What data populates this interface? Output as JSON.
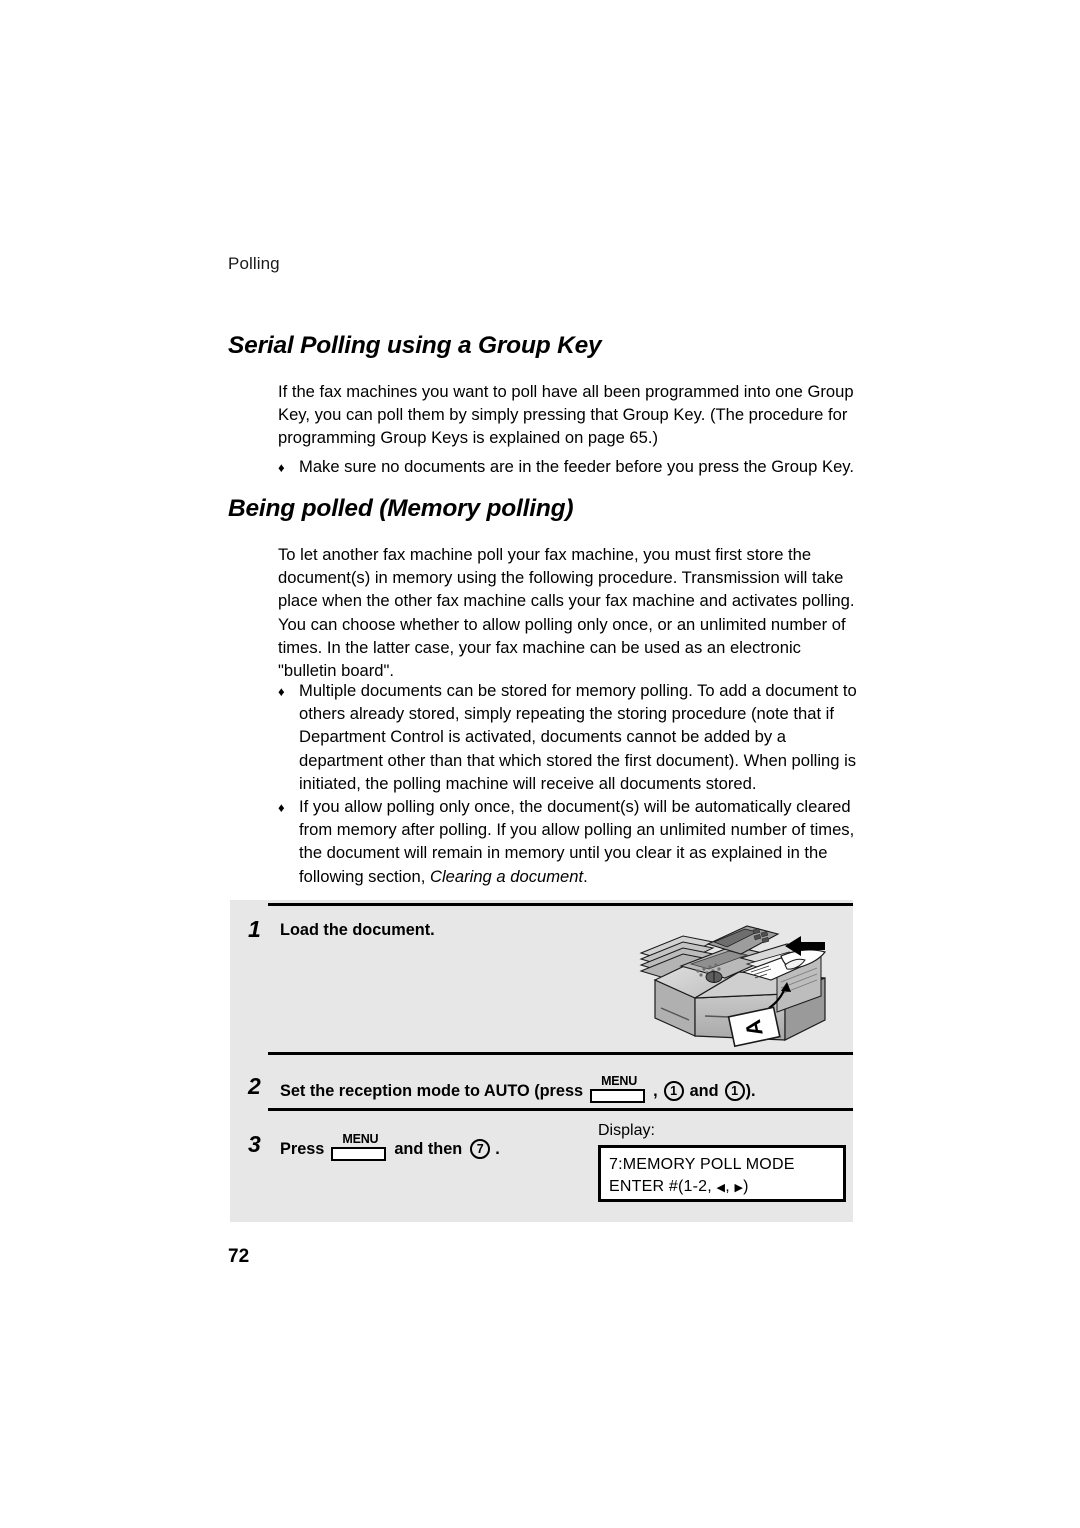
{
  "page": {
    "running_head": "Polling",
    "page_number": "72"
  },
  "sections": [
    {
      "heading": "Serial Polling using a Group Key",
      "paragraph": "If the fax machines you want to poll have all been programmed into one Group Key, you can poll them by simply pressing that Group Key. (The procedure for programming Group Keys is explained on page 65.)",
      "bullet": "Make sure no documents are in the feeder before you press the Group Key."
    },
    {
      "heading": "Being polled (Memory polling)",
      "paragraph": "To let another fax machine poll your fax machine, you must first store the document(s) in memory using the following procedure. Transmission will take place when the other fax machine calls your fax machine and activates polling. You can choose whether to allow polling only once, or an unlimited number of times. In the latter case, your fax machine can be used as an electronic \"bulletin board\".",
      "bullets": [
        "Multiple documents can be stored for memory polling. To add a document to others already stored, simply repeating the storing procedure (note that if Department Control is activated, documents cannot be added by a department other than that which stored the first document). When polling is initiated, the polling machine will receive all documents stored.",
        {
          "lead": "If you allow polling only once, the document(s) will be automatically cleared from memory after polling. If you allow polling an unlimited number of times, the document will remain in memory until you clear it as explained in the following section, ",
          "italic": "Clearing a document",
          "tail": "."
        }
      ]
    }
  ],
  "bullet_marker": "♦",
  "procedure": {
    "steps": [
      {
        "number": "1",
        "text": "Load the document.",
        "illustration": "fax-machine-loading-document"
      },
      {
        "number": "2",
        "text_before": "Set the reception mode to AUTO (press",
        "key1": "MENU",
        "sep": ",",
        "key2": "1",
        "text_mid": "and",
        "key3": "1",
        "text_after": ")."
      },
      {
        "number": "3",
        "text_before": "Press",
        "key1": "MENU",
        "text_mid": "and then",
        "key2": "7",
        "text_after": "."
      }
    ],
    "display": {
      "label": "Display:",
      "line1": "7:MEMORY POLL MODE",
      "line2_prefix": "ENTER #(1-2, ",
      "line2_left_arrow": "◀",
      "line2_comma": ", ",
      "line2_right_arrow": "▶",
      "line2_suffix": ")"
    }
  },
  "colors": {
    "page_background": "#ffffff",
    "procedure_background": "#e7e7e7",
    "text": "#000000",
    "rule": "#000000"
  }
}
